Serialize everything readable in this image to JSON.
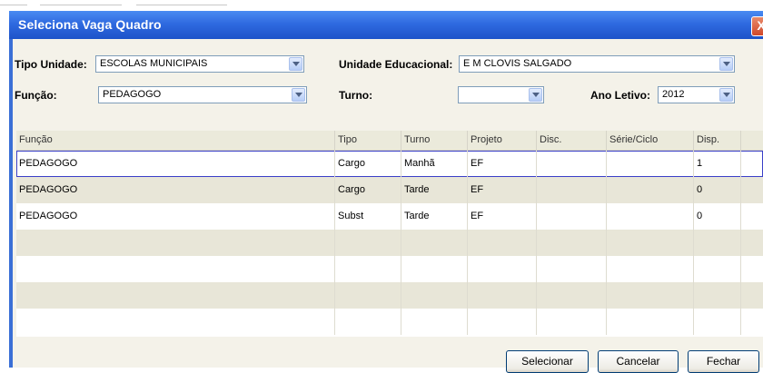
{
  "window": {
    "title": "Seleciona Vaga Quadro",
    "close_label": "X"
  },
  "filters": {
    "tipo_unidade": {
      "label": "Tipo Unidade:",
      "value": "ESCOLAS MUNICIPAIS"
    },
    "unidade_educacional": {
      "label": "Unidade Educacional:",
      "value": "E M CLOVIS SALGADO"
    },
    "funcao": {
      "label": "Função:",
      "value": "PEDAGOGO"
    },
    "turno": {
      "label": "Turno:",
      "value": ""
    },
    "ano_letivo": {
      "label": "Ano Letivo:",
      "value": "2012"
    }
  },
  "table": {
    "columns": [
      "Função",
      "Tipo",
      "Turno",
      "Projeto",
      "Disc.",
      "Série/Ciclo",
      "Disp."
    ],
    "rows": [
      [
        "PEDAGOGO",
        "Cargo",
        "Manhã",
        "EF",
        "",
        "",
        "1"
      ],
      [
        "PEDAGOGO",
        "Cargo",
        "Tarde",
        "EF",
        "",
        "",
        "0"
      ],
      [
        "PEDAGOGO",
        "Subst",
        "Tarde",
        "EF",
        "",
        "",
        "0"
      ],
      [
        "",
        "",
        "",
        "",
        "",
        "",
        ""
      ],
      [
        "",
        "",
        "",
        "",
        "",
        "",
        ""
      ],
      [
        "",
        "",
        "",
        "",
        "",
        "",
        ""
      ],
      [
        "",
        "",
        "",
        "",
        "",
        "",
        ""
      ]
    ],
    "selected_row": 0
  },
  "buttons": {
    "selecionar": "Selecionar",
    "cancelar": "Cancelar",
    "fechar": "Fechar"
  },
  "colors": {
    "titlebar": "#2f6ae0",
    "client_bg": "#f4f2e9",
    "alt_row": "#e8e6d8",
    "selection_border": "#3a3fc8"
  }
}
